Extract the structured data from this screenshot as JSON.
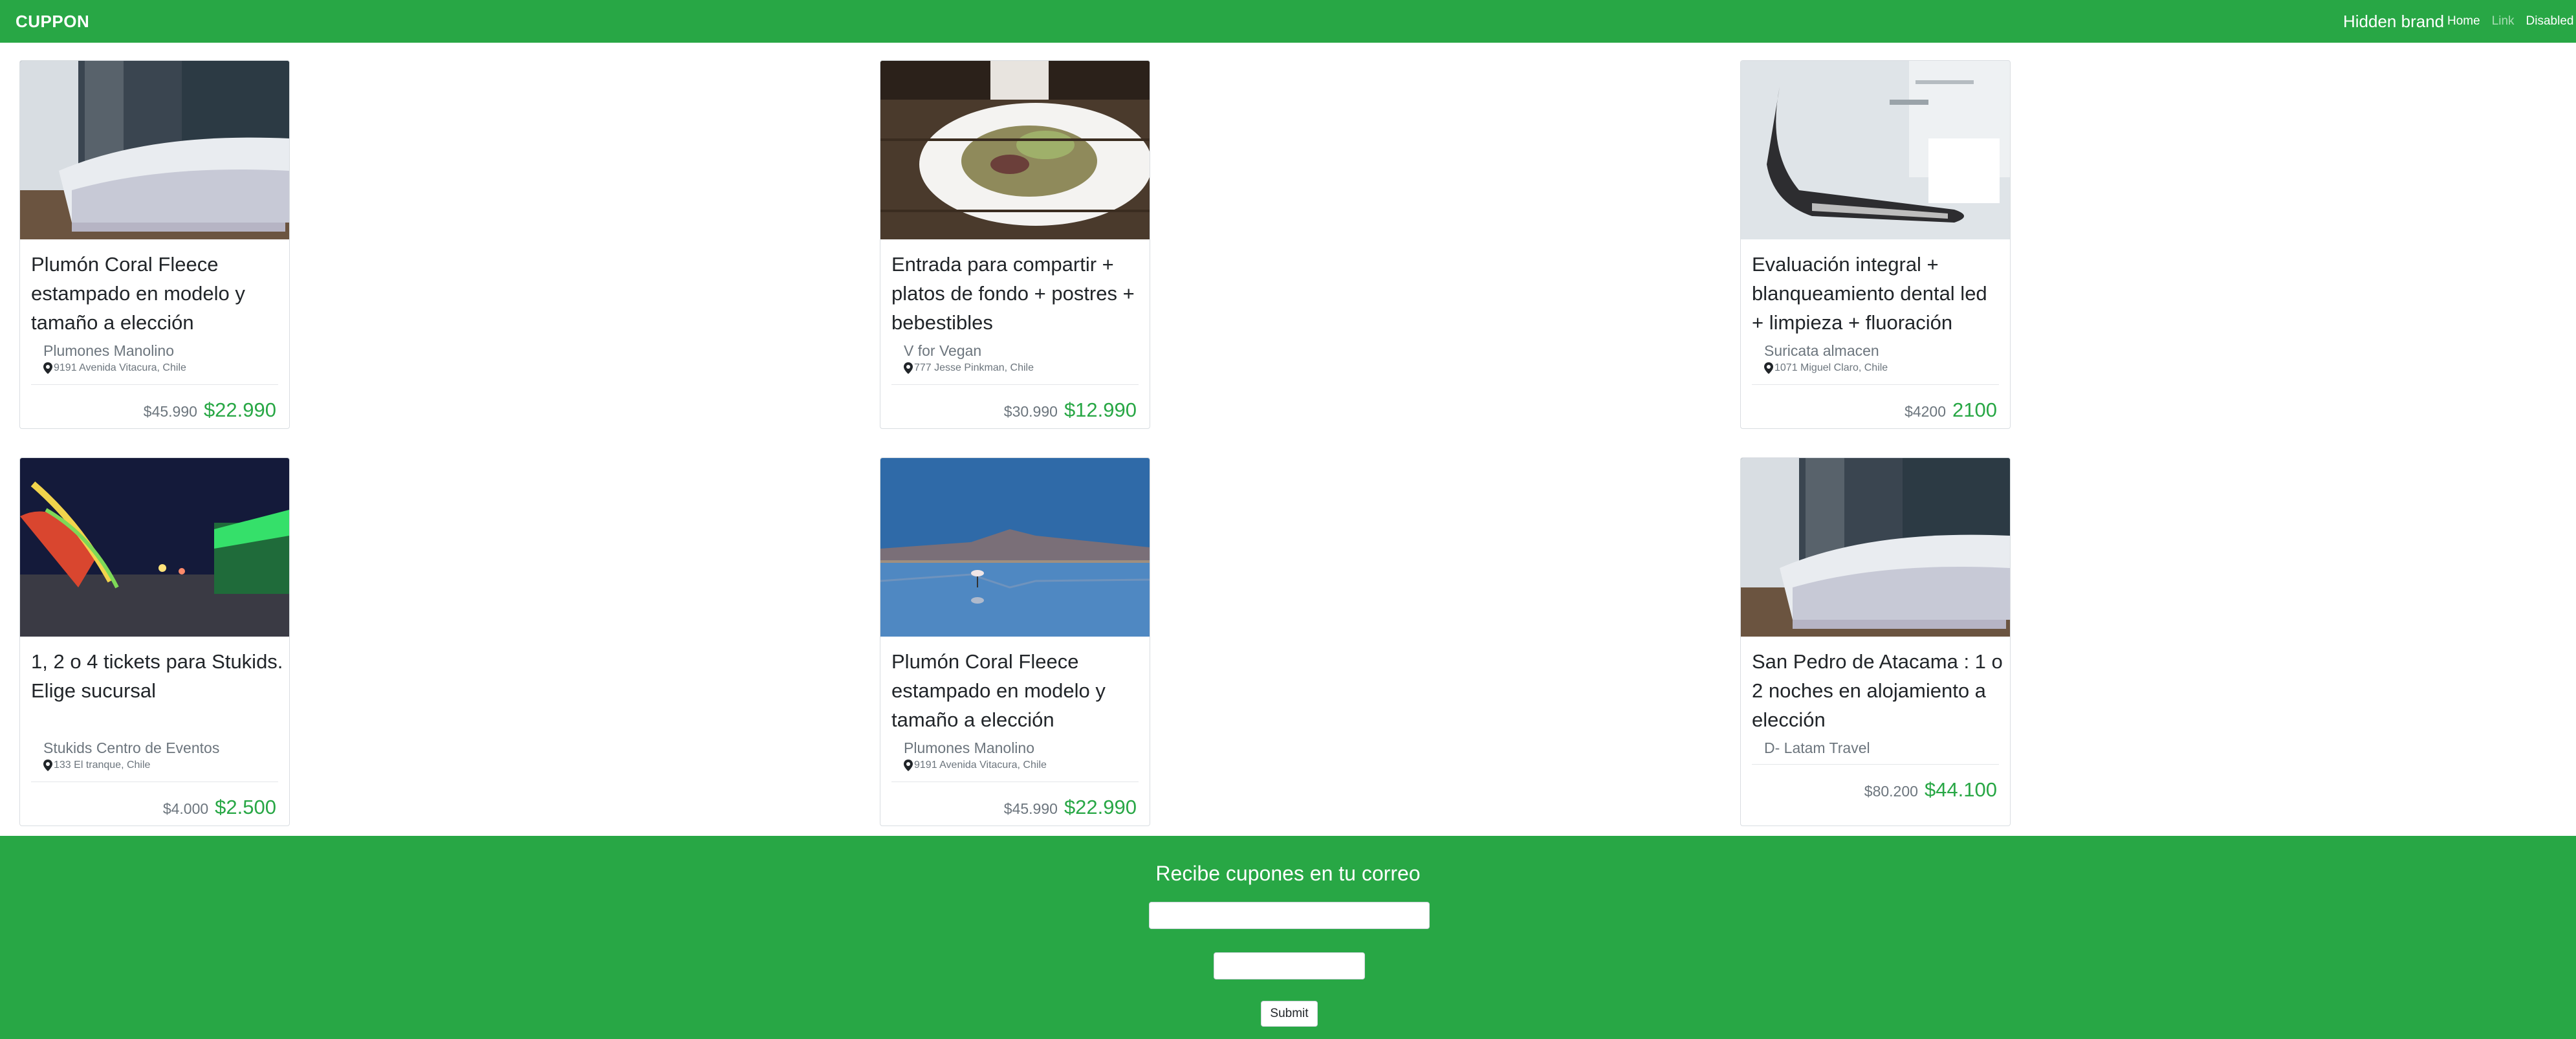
{
  "navbar": {
    "brand": "CUPPON",
    "hidden_brand": "Hidden brand",
    "links": [
      "Home",
      "Link",
      "Disabled"
    ]
  },
  "cards": [
    {
      "image": "bedroom-photo",
      "title": "Plumón Coral Fleece estampado en modelo y tamaño a elección",
      "merchant": "Plumones Manolino",
      "address": "9191 Avenida Vitacura, Chile",
      "old_price": "$45.990",
      "new_price": "$22.990"
    },
    {
      "image": "salad-plate-photo",
      "title": "Entrada para compartir + platos de fondo + postres + bebestibles",
      "merchant": "V for Vegan",
      "address": "777 Jesse Pinkman, Chile",
      "old_price": "$30.990",
      "new_price": "$12.990"
    },
    {
      "image": "dental-chair-photo",
      "title": "Evaluación integral + blanqueamiento dental led + limpieza + fluoración",
      "merchant": "Suricata almacen",
      "address": "1071 Miguel Claro, Chile",
      "old_price": "$4200",
      "new_price": "2100"
    },
    {
      "image": "amusement-park-photo",
      "title": "1, 2 o 4 tickets para Stukids. Elige sucursal",
      "merchant": "Stukids Centro de Eventos",
      "address": "133 El tranque, Chile",
      "old_price": "$4.000",
      "new_price": "$2.500"
    },
    {
      "image": "flamingo-lake-photo",
      "title": "Plumón Coral Fleece estampado en modelo y tamaño a elección",
      "merchant": "Plumones Manolino",
      "address": "9191 Avenida Vitacura, Chile",
      "old_price": "$45.990",
      "new_price": "$22.990"
    },
    {
      "image": "bedroom-photo",
      "title": "San Pedro de Atacama : 1 o 2 noches en alojamiento a elección",
      "merchant": "D- Latam Travel",
      "address": "",
      "old_price": "$80.200",
      "new_price": "$44.100"
    }
  ],
  "footer": {
    "title": "Recibe cupones en tu correo",
    "email_value": "",
    "second_value": "",
    "submit_label": "Submit"
  },
  "colors": {
    "primary": "#28a745",
    "muted": "#6c757d"
  }
}
